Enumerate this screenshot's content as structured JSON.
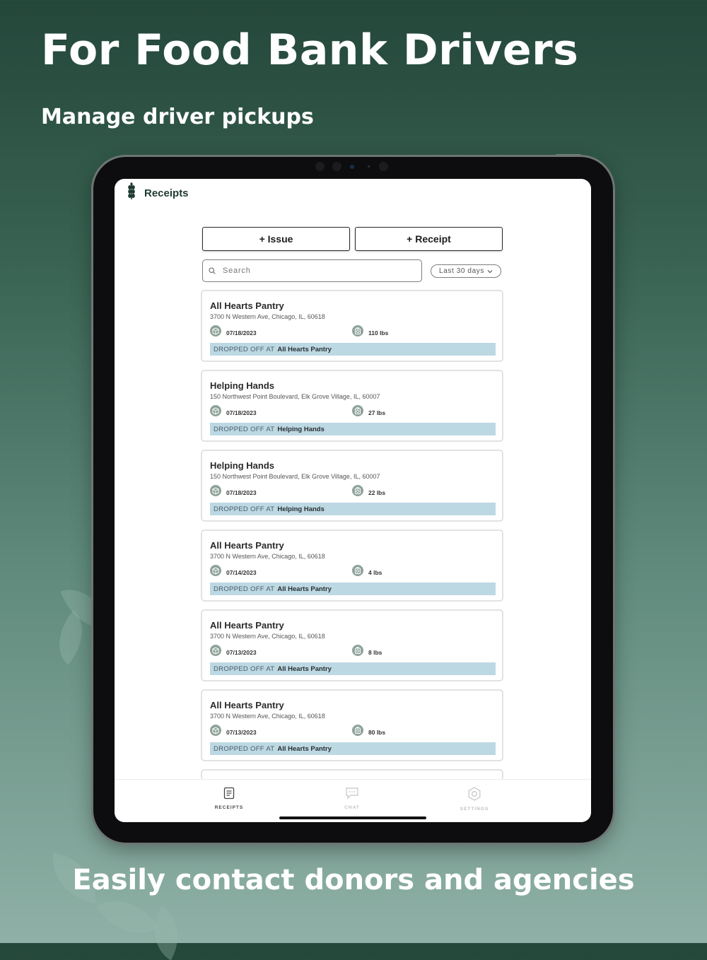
{
  "headline": "For Food Bank Drivers",
  "subheadline": "Manage driver pickups",
  "footer_tagline": "Easily contact donors and agencies",
  "app": {
    "title": "Receipts",
    "issue_button": "+ Issue",
    "receipt_button": "+ Receipt",
    "search_placeholder": "Search",
    "range_filter": "Last 30 days",
    "drop_prefix": "DROPPED OFF AT",
    "receipts": [
      {
        "name": "All Hearts Pantry",
        "address": "3700 N Western Ave, Chicago, IL, 60618",
        "date": "07/18/2023",
        "weight": "110 lbs",
        "dropped_at": "All Hearts Pantry"
      },
      {
        "name": "Helping Hands",
        "address": "150 Northwest Point Boulevard, Elk Grove Village, IL, 60007",
        "date": "07/18/2023",
        "weight": "27 lbs",
        "dropped_at": "Helping Hands"
      },
      {
        "name": "Helping Hands",
        "address": "150 Northwest Point Boulevard, Elk Grove Village, IL, 60007",
        "date": "07/18/2023",
        "weight": "22 lbs",
        "dropped_at": "Helping Hands"
      },
      {
        "name": "All Hearts Pantry",
        "address": "3700 N Western Ave, Chicago, IL, 60618",
        "date": "07/14/2023",
        "weight": "4 lbs",
        "dropped_at": "All Hearts Pantry"
      },
      {
        "name": "All Hearts Pantry",
        "address": "3700 N Western Ave, Chicago, IL, 60618",
        "date": "07/13/2023",
        "weight": "8 lbs",
        "dropped_at": "All Hearts Pantry"
      },
      {
        "name": "All Hearts Pantry",
        "address": "3700 N Western Ave, Chicago, IL, 60618",
        "date": "07/13/2023",
        "weight": "80 lbs",
        "dropped_at": "All Hearts Pantry"
      }
    ],
    "tabs": [
      {
        "label": "RECEIPTS",
        "icon": "receipt-icon",
        "active": true
      },
      {
        "label": "CHAT",
        "icon": "chat-icon",
        "active": false
      },
      {
        "label": "SETTINGS",
        "icon": "settings-icon",
        "active": false
      }
    ]
  },
  "colors": {
    "background_top": "#24473a",
    "background_bottom": "#8fb0a6",
    "drop_bar": "#bcd8e3",
    "icon_badge": "#8ea39a"
  }
}
